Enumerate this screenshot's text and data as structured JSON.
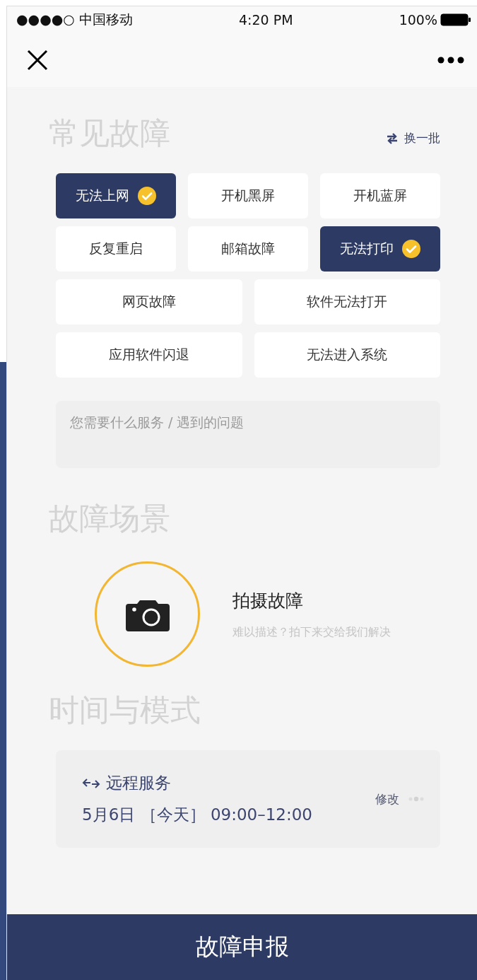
{
  "status_bar": {
    "carrier": "●●●●○ 中国移动",
    "time": "4:20 PM",
    "battery": "100%"
  },
  "common_faults": {
    "title": "常见故障",
    "refresh": "换一批",
    "rows": [
      [
        {
          "label": "无法上网",
          "selected": true
        },
        {
          "label": "开机黑屏",
          "selected": false
        },
        {
          "label": "开机蓝屏",
          "selected": false
        }
      ],
      [
        {
          "label": "反复重启",
          "selected": false
        },
        {
          "label": "邮箱故障",
          "selected": false
        },
        {
          "label": "无法打印",
          "selected": true
        }
      ],
      [
        {
          "label": "网页故障",
          "selected": false
        },
        {
          "label": "软件无法打开",
          "selected": false
        }
      ],
      [
        {
          "label": "应用软件闪退",
          "selected": false
        },
        {
          "label": "无法进入系统",
          "selected": false
        }
      ]
    ],
    "description": {
      "placeholder": "您需要什么服务 / 遇到的问题"
    }
  },
  "scene": {
    "title": "故障场景",
    "capture_title": "拍摄故障",
    "capture_hint": "难以描述？拍下来交给我们解决"
  },
  "schedule": {
    "title": "时间与模式",
    "mode": "远程服务",
    "date": "5月6日 ［今天］ 09:00–12:00",
    "edit": "修改"
  },
  "submit": "故障申报"
}
